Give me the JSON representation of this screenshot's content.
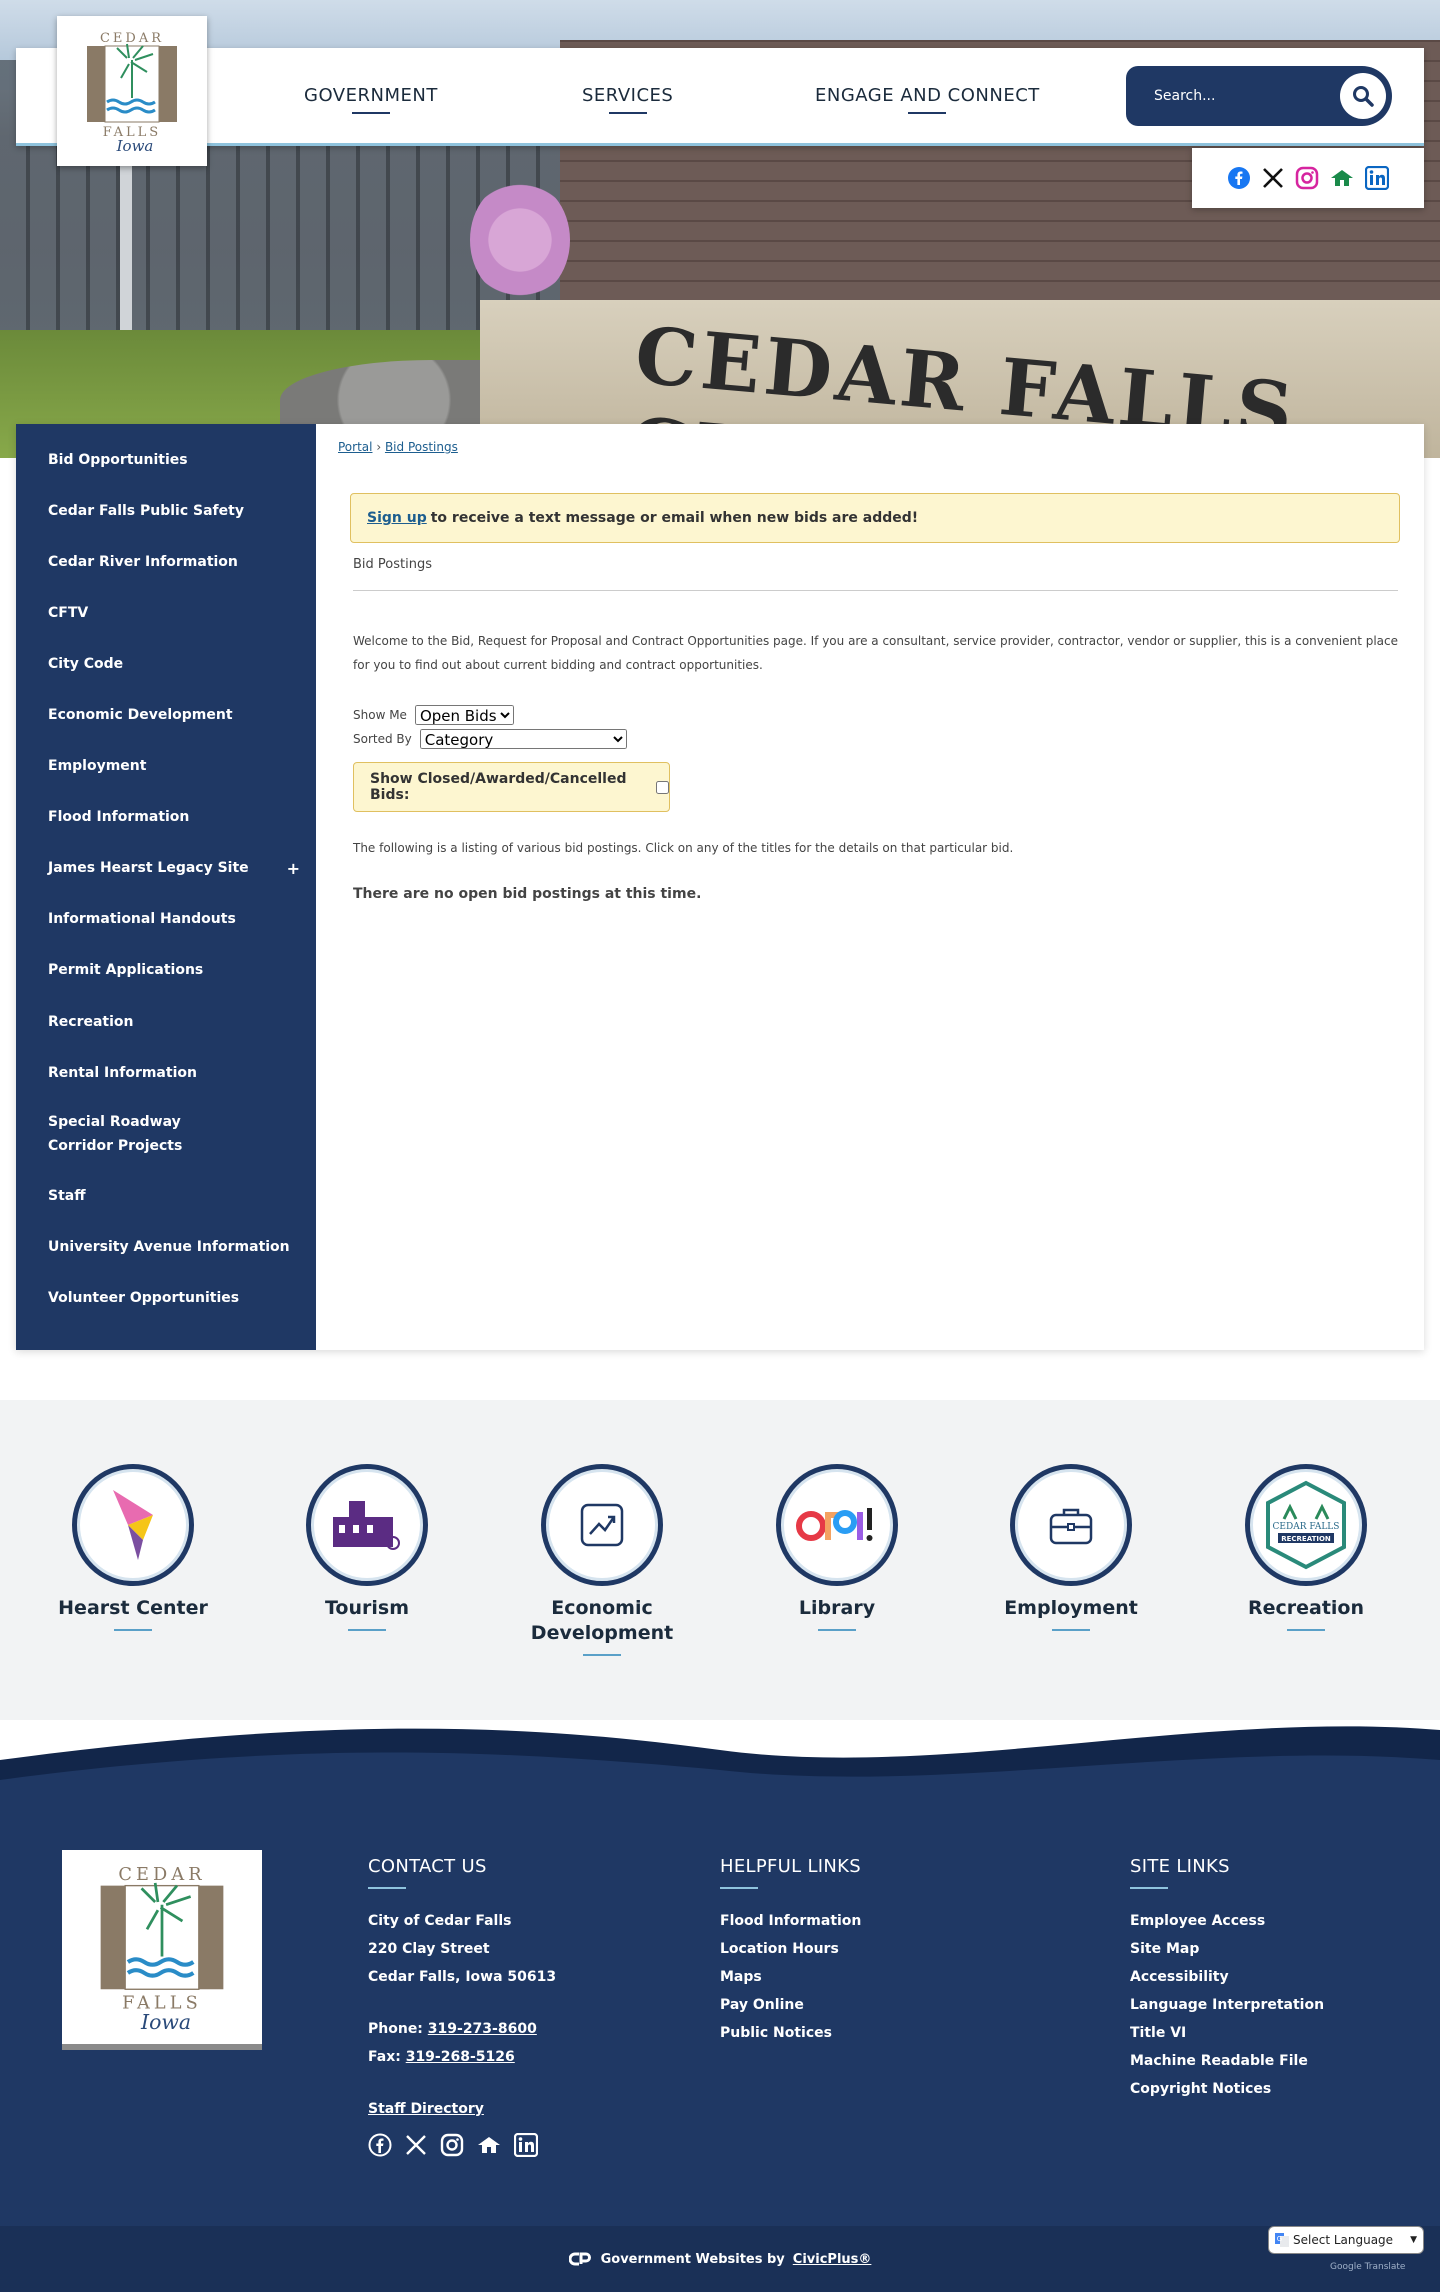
{
  "header": {
    "logo": {
      "line1": "CEDAR",
      "line2": "FALLS",
      "line3": "Iowa"
    },
    "nav": [
      {
        "label": "GOVERNMENT"
      },
      {
        "label": "SERVICES"
      },
      {
        "label": "ENGAGE AND CONNECT"
      }
    ],
    "search": {
      "placeholder": "Search..."
    },
    "hero_sign_text": "CEDAR FALLS CITY"
  },
  "sidebar": {
    "items": [
      {
        "label": "Bid Opportunities"
      },
      {
        "label": "Cedar Falls Public Safety"
      },
      {
        "label": "Cedar River Information"
      },
      {
        "label": "CFTV"
      },
      {
        "label": "City Code"
      },
      {
        "label": "Economic Development"
      },
      {
        "label": "Employment"
      },
      {
        "label": "Flood Information"
      },
      {
        "label": "James Hearst Legacy Site",
        "expand": "+"
      },
      {
        "label": "Informational Handouts"
      },
      {
        "label": "Permit Applications"
      },
      {
        "label": "Recreation"
      },
      {
        "label": "Rental Information"
      },
      {
        "label": "Special Roadway Corridor Projects"
      },
      {
        "label": "Staff"
      },
      {
        "label": "University Avenue Information"
      },
      {
        "label": "Volunteer Opportunities"
      }
    ]
  },
  "content": {
    "breadcrumb": {
      "home": "Portal",
      "sep": "›",
      "current": "Bid Postings"
    },
    "signup": {
      "link": "Sign up",
      "text": "to receive a text message or email when new bids are added!"
    },
    "section_title": "Bid Postings",
    "intro": "Welcome to the Bid, Request for Proposal and Contract Opportunities page. If you are a consultant, service provider, contractor, vendor or supplier, this is a convenient place for you to find out about current bidding and contract opportunities.",
    "show_me": {
      "label": "Show Me",
      "value": "Open Bids"
    },
    "sorted_by": {
      "label": "Sorted By",
      "value": "Category"
    },
    "closed_label": "Show Closed/Awarded/Cancelled Bids:",
    "listing_text": "The following is a listing of various bid postings. Click on any of the titles for the details on that particular bid.",
    "no_open_text": "There are no open bid postings at this time."
  },
  "quick_links": [
    {
      "label": "Hearst Center",
      "icon": "hearst-center-icon"
    },
    {
      "label": "Tourism",
      "icon": "tourism-icon"
    },
    {
      "label": "Economic Development",
      "icon": "economic-development-icon"
    },
    {
      "label": "Library",
      "icon": "library-icon"
    },
    {
      "label": "Employment",
      "icon": "employment-icon"
    },
    {
      "label": "Recreation",
      "icon": "recreation-icon"
    }
  ],
  "footer": {
    "contact": {
      "heading": "CONTACT US",
      "org": "City of Cedar Falls",
      "street": "220 Clay Street",
      "city": "Cedar Falls, Iowa 50613",
      "phone_label": "Phone:",
      "phone": "319-273-8600",
      "fax_label": "Fax:",
      "fax": "319-268-5126",
      "staff_directory": "Staff Directory"
    },
    "helpful": {
      "heading": "HELPFUL LINKS",
      "links": [
        "Flood Information",
        "Location Hours",
        "Maps",
        "Pay Online",
        "Public Notices"
      ]
    },
    "site": {
      "heading": "SITE LINKS",
      "links": [
        "Employee Access",
        "Site Map",
        "Accessibility",
        "Language Interpretation",
        "Title VI",
        "Machine Readable File",
        "Copyright Notices"
      ]
    },
    "bottom": {
      "text": "Government Websites by",
      "link": "CivicPlus®"
    },
    "language": {
      "label": "Select Language",
      "powered_by": "Google Translate"
    }
  },
  "colors": {
    "navy": "#1f3864",
    "accent_blue": "#8fc3dd",
    "notice_bg": "#fdf6d0",
    "link": "#1d5e8f"
  }
}
